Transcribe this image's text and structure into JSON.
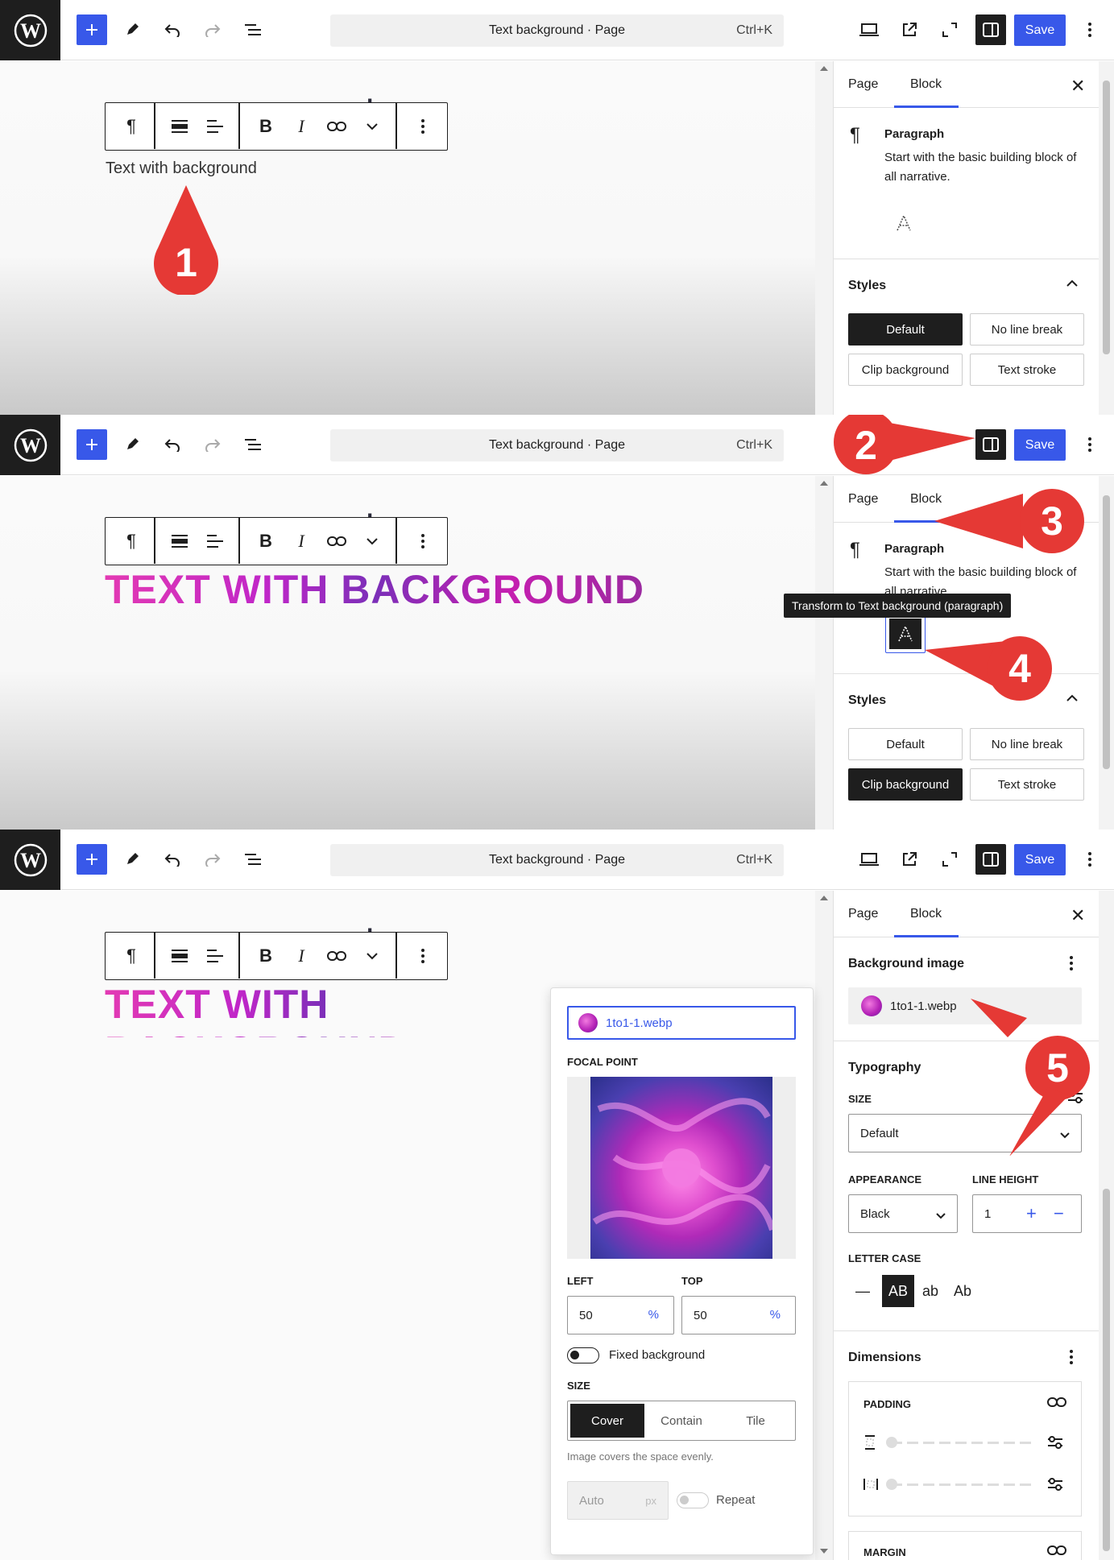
{
  "common": {
    "command_title": "Text background · Page",
    "command_shortcut": "Ctrl+K",
    "save_label": "Save",
    "tab_page": "Page",
    "tab_block": "Block",
    "heading_ghost": "ound",
    "block_title": "Paragraph",
    "block_desc": "Start with the basic building block of all narrative.",
    "styles_title": "Styles",
    "style_default": "Default",
    "style_no_line_break": "No line break",
    "style_clip_background": "Clip background",
    "style_text_stroke": "Text stroke",
    "accent_color": "#3858e9",
    "callout_color": "#e53935"
  },
  "panel1": {
    "paragraph_text": "Text with background",
    "callout": "1"
  },
  "panel2": {
    "paragraph_text": "TEXT WITH BACKGROUND",
    "tooltip": "Transform to Text background (paragraph)",
    "callouts": [
      "2",
      "3",
      "4"
    ]
  },
  "panel3": {
    "paragraph_text": "TEXT WITH BACKGROUND",
    "callout": "5",
    "background_image_title": "Background image",
    "background_image_file": "1to1-1.webp",
    "typography_title": "Typography",
    "size_label": "Size",
    "size_value": "Default",
    "appearance_label": "Appearance",
    "appearance_value": "Black",
    "line_height_label": "Line height",
    "line_height_value": "1",
    "letter_case_label": "Letter case",
    "letter_case_options": [
      "—",
      "AB",
      "ab",
      "Ab"
    ],
    "letter_case_selected": "AB",
    "dimensions_title": "Dimensions",
    "padding_label": "Padding",
    "margin_label": "Margin",
    "popover": {
      "file": "1to1-1.webp",
      "focal_point_label": "Focal point",
      "left_label": "Left",
      "left_value": "50",
      "top_label": "Top",
      "top_value": "50",
      "unit": "%",
      "fixed_background": "Fixed background",
      "size_label": "Size",
      "size_options": [
        "Cover",
        "Contain",
        "Tile"
      ],
      "size_selected": "Cover",
      "size_help": "Image covers the space evenly.",
      "auto_placeholder": "Auto",
      "px_unit": "px",
      "repeat_label": "Repeat"
    }
  }
}
